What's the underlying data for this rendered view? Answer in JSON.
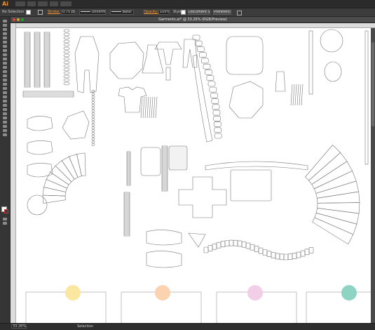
{
  "app": {
    "logo_text": "Ai"
  },
  "control_bar": {
    "selection_label": "No Selection",
    "stroke_label": "Stroke:",
    "stroke_weight": "0.75 pt",
    "profile_label": "Uniform",
    "brush_label": "Basic",
    "opacity_label": "Opacity:",
    "opacity_value": "100%",
    "style_label": "Style:",
    "document_setup_label": "Document Setup",
    "preferences_label": "Preferences"
  },
  "document": {
    "tab_title": "Garments.ai* @ 33.26% (RGB/Preview)"
  },
  "status_bar": {
    "zoom": "33.26%",
    "mode": "Selection"
  },
  "colors": {
    "accent": "#ff9c2a",
    "circle_yellow": "#fbe7a0",
    "circle_peach": "#fbd3b0",
    "circle_pink": "#f2cfe6",
    "circle_teal": "#8fd3c4"
  }
}
